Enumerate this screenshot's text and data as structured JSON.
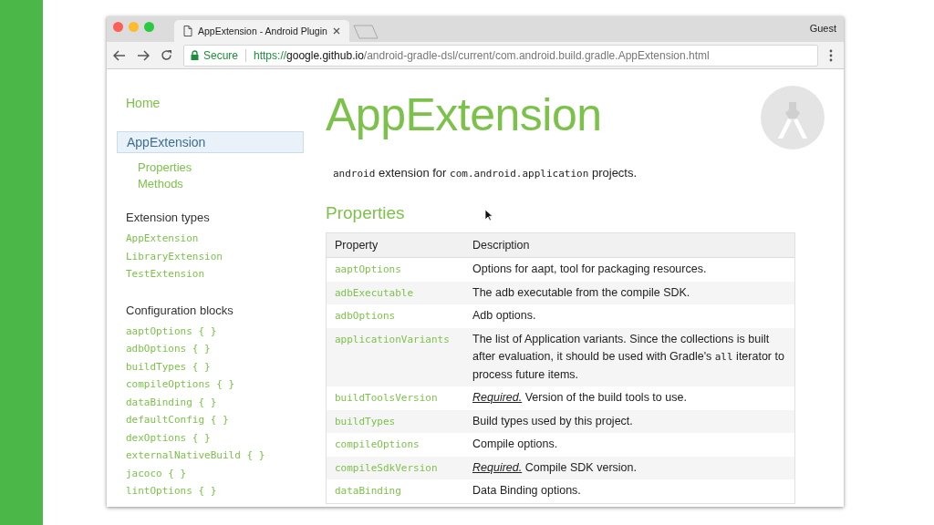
{
  "browser": {
    "tabs": [
      {
        "title": "AppExtension - Android Plugin",
        "selected": true
      }
    ],
    "profile": "Guest",
    "address": {
      "security": "Secure",
      "scheme": "https://",
      "host": "google.github.io",
      "path": "/android-gradle-dsl/current/com.android.build.gradle.AppExtension.html"
    }
  },
  "sidebar": {
    "nav": [
      {
        "label": "Home",
        "selected": false
      },
      {
        "label": "AppExtension",
        "selected": true,
        "children": [
          {
            "label": "Properties"
          },
          {
            "label": "Methods"
          }
        ]
      }
    ],
    "sections": [
      {
        "heading": "Extension types",
        "items": [
          "AppExtension",
          "LibraryExtension",
          "TestExtension"
        ]
      },
      {
        "heading": "Configuration blocks",
        "items": [
          "aaptOptions { }",
          "adbOptions { }",
          "buildTypes { }",
          "compileOptions { }",
          "dataBinding { }",
          "defaultConfig { }",
          "dexOptions { }",
          "externalNativeBuild { }",
          "jacoco { }",
          "lintOptions { }"
        ]
      }
    ]
  },
  "main": {
    "title": "AppExtension",
    "intro": [
      {
        "kind": "code",
        "text": "android"
      },
      {
        "kind": "text",
        "text": " extension for "
      },
      {
        "kind": "code",
        "text": "com.android.application"
      },
      {
        "kind": "text",
        "text": " projects."
      }
    ],
    "section": "Properties",
    "columns": [
      "Property",
      "Description"
    ],
    "rows": [
      {
        "name": "aaptOptions",
        "description": [
          {
            "kind": "text",
            "text": "Options for aapt, tool for packaging resources."
          }
        ]
      },
      {
        "name": "adbExecutable",
        "description": [
          {
            "kind": "text",
            "text": "The adb executable from the compile SDK."
          }
        ]
      },
      {
        "name": "adbOptions",
        "description": [
          {
            "kind": "text",
            "text": "Adb options."
          }
        ]
      },
      {
        "name": "applicationVariants",
        "description": [
          {
            "kind": "text",
            "text": "The list of Application variants. Since the collections is built after evaluation, it should be used with Gradle's "
          },
          {
            "kind": "code",
            "text": "all"
          },
          {
            "kind": "text",
            "text": " iterator to process future items."
          }
        ]
      },
      {
        "name": "buildToolsVersion",
        "description": [
          {
            "kind": "em",
            "text": "Required."
          },
          {
            "kind": "text",
            "text": " Version of the build tools to use."
          }
        ]
      },
      {
        "name": "buildTypes",
        "description": [
          {
            "kind": "text",
            "text": "Build types used by this project."
          }
        ]
      },
      {
        "name": "compileOptions",
        "description": [
          {
            "kind": "text",
            "text": "Compile options."
          }
        ]
      },
      {
        "name": "compileSdkVersion",
        "description": [
          {
            "kind": "em",
            "text": "Required."
          },
          {
            "kind": "text",
            "text": " Compile SDK version."
          }
        ]
      },
      {
        "name": "dataBinding",
        "description": [
          {
            "kind": "text",
            "text": "Data Binding options."
          }
        ]
      }
    ]
  }
}
